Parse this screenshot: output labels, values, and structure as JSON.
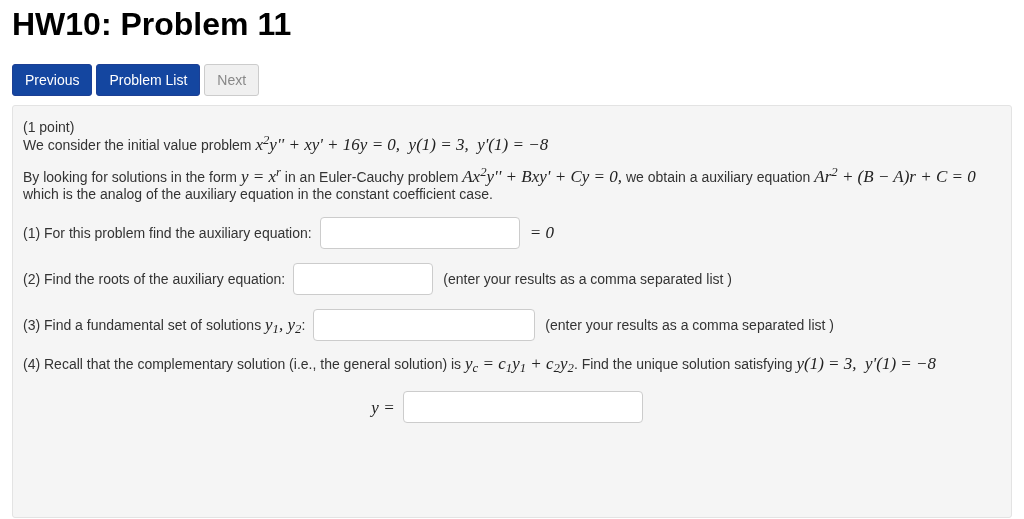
{
  "title": "HW10: Problem 11",
  "nav_buttons": [
    {
      "label": "Previous",
      "disabled": false
    },
    {
      "label": "Problem List",
      "disabled": false
    },
    {
      "label": "Next",
      "disabled": true
    }
  ],
  "points": "(1 point)",
  "intro": [
    {
      "kind": "text",
      "text": "We consider the initial value problem "
    },
    {
      "kind": "math",
      "text": "x$^{2}$y'' + xy' + 16y = 0,  y(1) = 3,  y'(1) = −8"
    }
  ],
  "explanation": [
    {
      "kind": "text",
      "text": "By looking for solutions in the form "
    },
    {
      "kind": "math",
      "text": "y = x$^{r}$"
    },
    {
      "kind": "text",
      "text": " in an Euler-Cauchy problem "
    },
    {
      "kind": "math",
      "text": "Ax$^{2}$y'' + Bxy' + Cy = 0,"
    },
    {
      "kind": "text",
      "text": " we obtain a auxiliary equation "
    },
    {
      "kind": "math",
      "text": "Ar$^{2}$ + (B − A)r + C = 0"
    },
    {
      "kind": "text",
      "text": " which is the analog of the auxiliary equation in the constant coefficient case."
    }
  ],
  "parts": [
    {
      "kind": "inline",
      "prompt": [
        {
          "kind": "text",
          "text": "(1) For this problem find the auxiliary equation:"
        }
      ],
      "suffix": {
        "kind": "math",
        "text": "= 0"
      }
    },
    {
      "kind": "inline",
      "prompt": [
        {
          "kind": "text",
          "text": "(2) Find the roots of the auxiliary equation:"
        }
      ],
      "suffix": {
        "kind": "text",
        "text": "(enter your results as a comma separated list )"
      }
    },
    {
      "kind": "inline",
      "prompt": [
        {
          "kind": "text",
          "text": "(3) Find a fundamental set of solutions "
        },
        {
          "kind": "math",
          "text": "y$_{1}$, y$_{2}$"
        },
        {
          "kind": "text",
          "text": ":"
        }
      ],
      "suffix": {
        "kind": "text",
        "text": "(enter your results as a comma separated list )"
      }
    },
    {
      "kind": "block",
      "prompt": [
        {
          "kind": "text",
          "text": "(4) Recall that the complementary solution (i.e., the general solution) is "
        },
        {
          "kind": "math",
          "text": "y$_{c}$ = c$_{1}$y$_{1}$ + c$_{2}$y$_{2}$"
        },
        {
          "kind": "text",
          "text": ". Find the unique solution satisfying "
        },
        {
          "kind": "math",
          "text": "y(1) = 3,  y'(1) = −8"
        }
      ],
      "answer_label": "y ="
    }
  ]
}
